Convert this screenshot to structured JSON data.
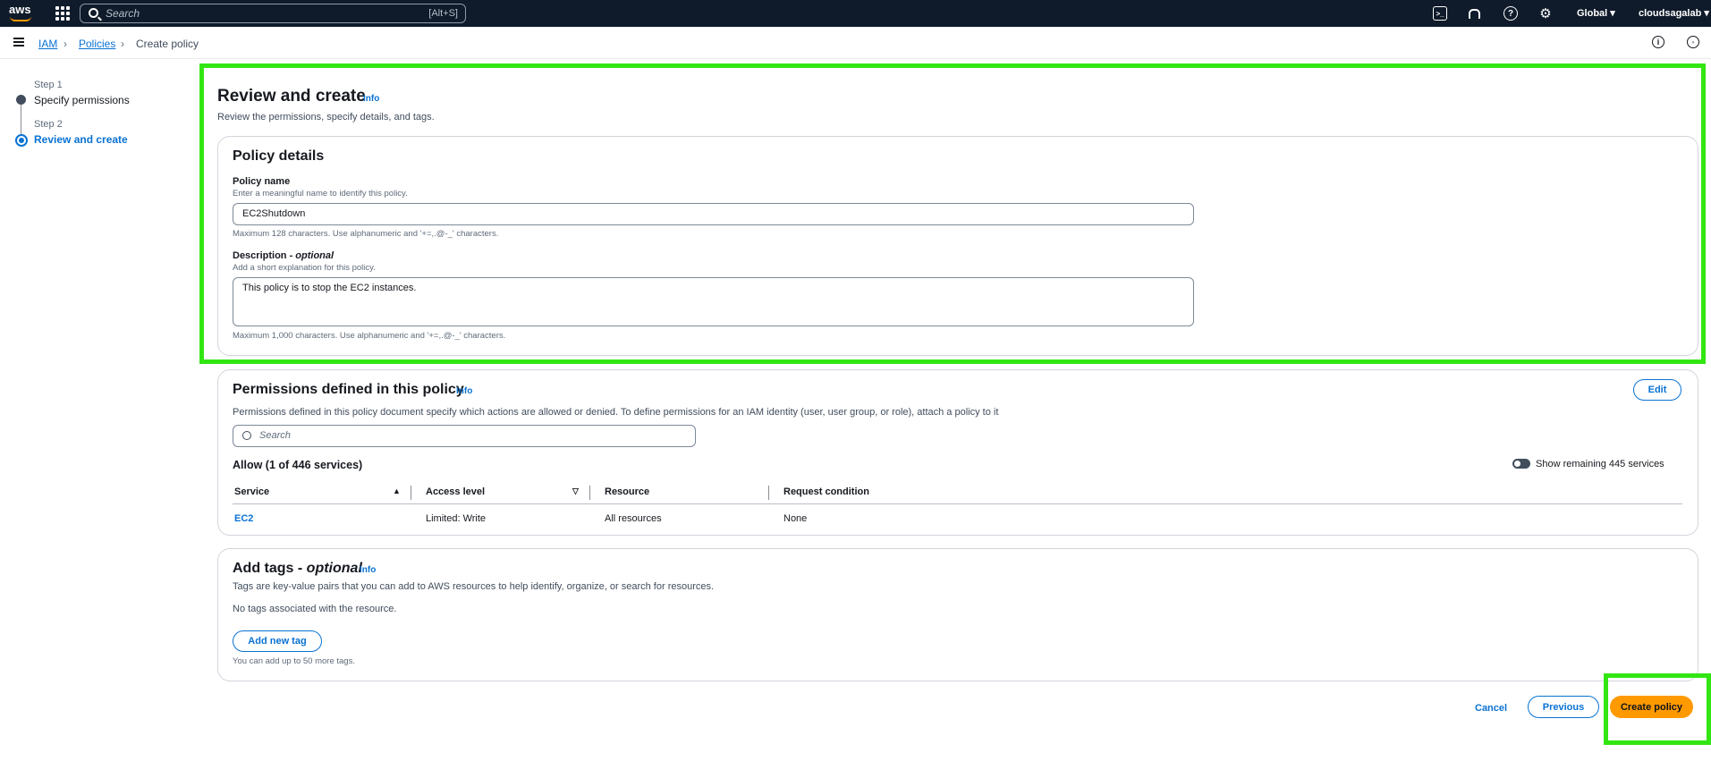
{
  "topbar": {
    "search_placeholder": "Search",
    "search_shortcut": "[Alt+S]",
    "region": "Global ▾",
    "account": "cloudsagalab ▾"
  },
  "breadcrumb": {
    "items": [
      "IAM",
      "Policies",
      "Create policy"
    ]
  },
  "steps": [
    {
      "label": "Step 1",
      "name": "Specify permissions"
    },
    {
      "label": "Step 2",
      "name": "Review and create"
    }
  ],
  "page": {
    "title": "Review and create",
    "info": "Info",
    "subtitle": "Review the permissions, specify details, and tags."
  },
  "policy_details": {
    "title": "Policy details",
    "name_label": "Policy name",
    "name_hint": "Enter a meaningful name to identify this policy.",
    "name_value": "EC2Shutdown",
    "name_constraint": "Maximum 128 characters. Use alphanumeric and '+=,.@-_' characters.",
    "desc_label": "Description - ",
    "desc_optional": "optional",
    "desc_hint": "Add a short explanation for this policy.",
    "desc_value": "This policy is to stop the EC2 instances.",
    "desc_constraint": "Maximum 1,000 characters. Use alphanumeric and '+=,.@-_' characters."
  },
  "permissions": {
    "title": "Permissions defined in this policy",
    "info": "Info",
    "edit": "Edit",
    "description": "Permissions defined in this policy document specify which actions are allowed or denied. To define permissions for an IAM identity (user, user group, or role), attach a policy to it",
    "search_placeholder": "Search",
    "allow_title": "Allow (1 of 446 services)",
    "toggle_label": "Show remaining 445 services",
    "columns": [
      "Service",
      "Access level",
      "Resource",
      "Request condition"
    ],
    "rows": [
      {
        "service": "EC2",
        "access": "Limited: Write",
        "resource": "All resources",
        "condition": "None"
      }
    ]
  },
  "tags": {
    "title": "Add tags - ",
    "optional": "optional",
    "info": "Info",
    "description": "Tags are key-value pairs that you can add to AWS resources to help identify, organize, or search for resources.",
    "empty": "No tags associated with the resource.",
    "add_button": "Add new tag",
    "limit": "You can add up to 50 more tags."
  },
  "footer": {
    "cancel": "Cancel",
    "previous": "Previous",
    "create": "Create policy"
  },
  "colors": {
    "accent": "#0972d3",
    "primary_button": "#ff9900",
    "topbar": "#0f1b2a",
    "highlight": "#32e612"
  }
}
